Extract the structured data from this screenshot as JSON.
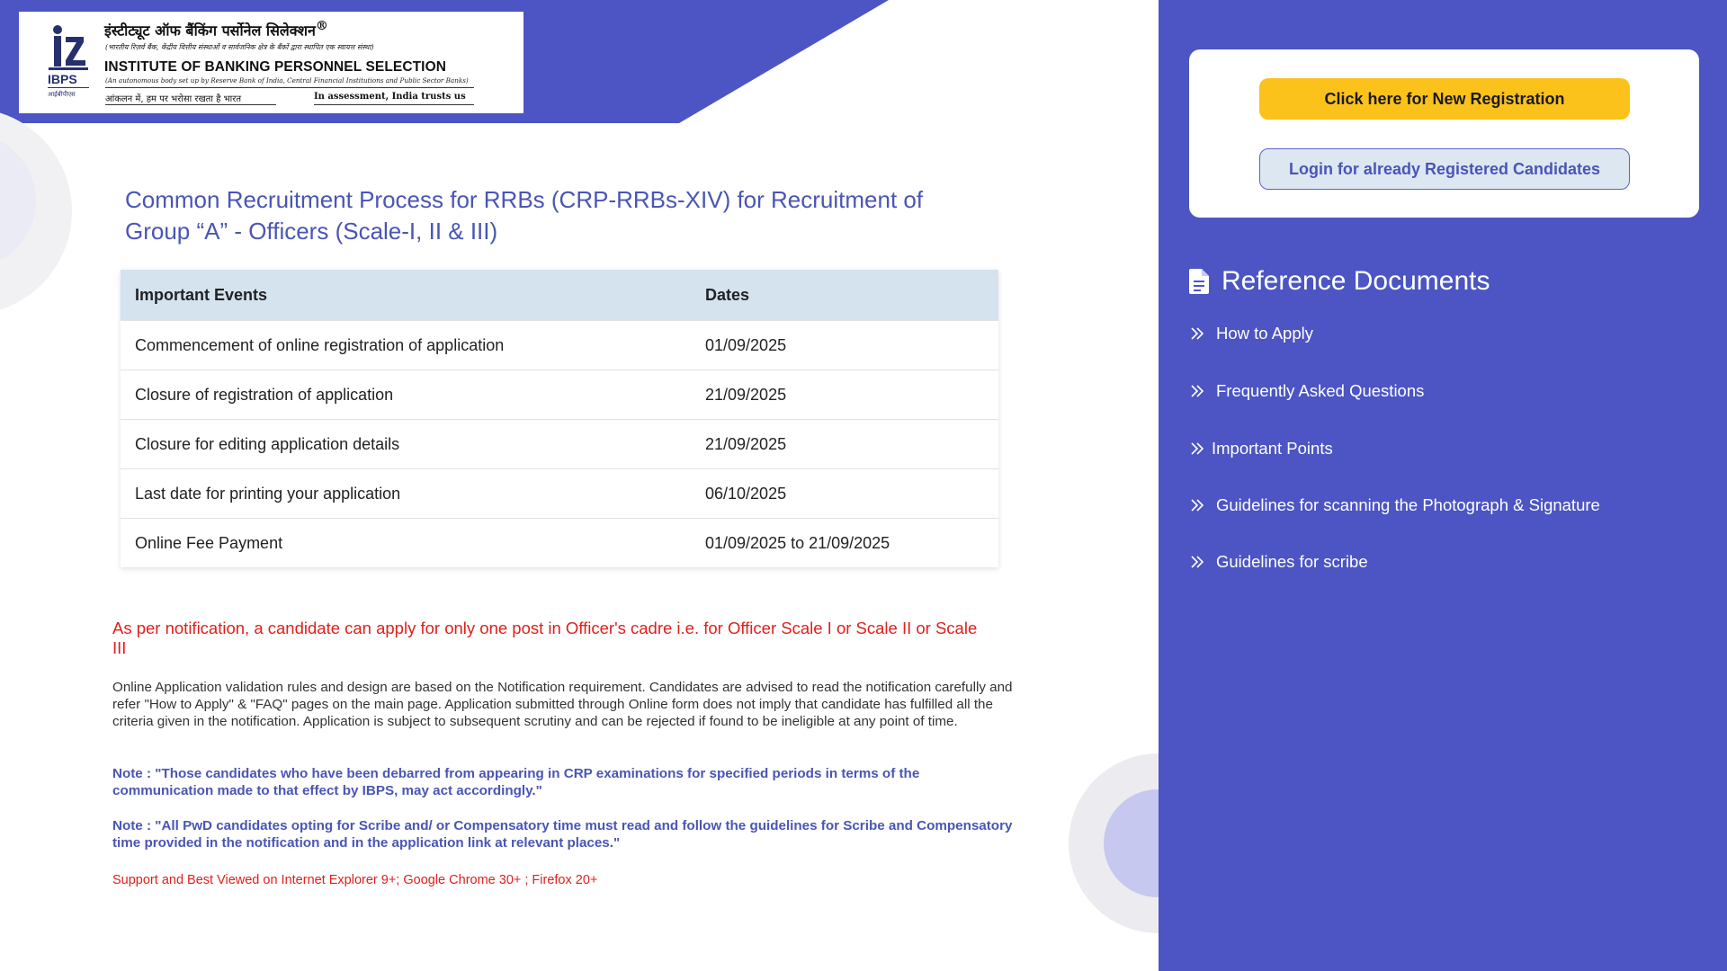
{
  "logo": {
    "hindi_title": "इंस्टीट्यूट ऑफ बैंकिंग पर्सोनेल सिलेक्शन",
    "registered_mark": "®",
    "hindi_subtitle": "(भारतीय रिज़र्व बैंक, केंद्रीय वित्तीय संस्थाओं व सार्वजनिक क्षेत्र के बैंकों द्वारा स्थापित एक स्वायत्त संस्था)",
    "english_title": "INSTITUTE OF BANKING PERSONNEL SELECTION",
    "english_subtitle": "(An autonomous body set up by Reserve Bank of India, Central Financial Institutions and Public Sector Banks)",
    "emblem_text": "IBPS",
    "emblem_hindi": "आईबीपीएस",
    "tagline_hindi": "आंकलन में, हम पर भरोसा रखता है भारत",
    "tagline_english": "In assessment, India trusts us"
  },
  "main": {
    "title": "Common Recruitment Process for RRBs (CRP-RRBs-XIV) for Recruitment of Group “A” - Officers (Scale-I, II & III)",
    "table": {
      "headers": [
        "Important Events",
        "Dates"
      ],
      "rows": [
        [
          "Commencement of online registration of application",
          "01/09/2025"
        ],
        [
          "Closure of registration of application",
          "21/09/2025"
        ],
        [
          "Closure for editing application details",
          "21/09/2025"
        ],
        [
          "Last date for printing your application",
          "06/10/2025"
        ],
        [
          "Online Fee Payment",
          "01/09/2025 to 21/09/2025"
        ]
      ]
    },
    "red_note": "As per notification, a candidate can apply for only one post in Officer's cadre i.e. for Officer Scale I or Scale II or Scale III",
    "paragraph": "Online Application validation rules and design are based on the Notification requirement. Candidates are advised to read the notification carefully and refer \"How to Apply\" & \"FAQ\" pages on the main page. Application submitted through Online form does not imply that candidate has fulfilled all the criteria given in the notification. Application is subject to subsequent scrutiny and can be rejected if found to be ineligible at any point of time.",
    "note1": "Note : \"Those candidates who have been debarred from appearing in CRP examinations for specified periods in terms of the communication made to that effect by IBPS, may act accordingly.\"",
    "note2": "Note : \"All PwD candidates opting for Scribe and/ or Compensatory time must read and follow the guidelines for Scribe and Compensatory time provided in the notification and in the application link at relevant places.\"",
    "support": "Support and Best Viewed on Internet Explorer 9+; Google Chrome 30+ ; Firefox 20+"
  },
  "sidebar": {
    "new_registration_label": "Click here for New Registration",
    "login_label": "Login for already Registered Candidates",
    "reference_title": "Reference Documents",
    "reference_icon": "document-icon",
    "items": [
      {
        "label": "How to Apply",
        "icon": "double-chevron-right-icon"
      },
      {
        "label": "Frequently Asked Questions",
        "icon": "double-chevron-right-icon"
      },
      {
        "label": "Important Points",
        "icon": "double-chevron-right-icon"
      },
      {
        "label": "Guidelines for scanning the Photograph & Signature",
        "icon": "double-chevron-right-icon"
      },
      {
        "label": "Guidelines for scribe",
        "icon": "double-chevron-right-icon"
      }
    ]
  },
  "colors": {
    "brand_blue": "#4c55c3",
    "accent_yellow": "#fcc21c",
    "title_blue": "#4a55b5",
    "alert_red": "#e0201c",
    "table_header": "#d5e3ef"
  }
}
